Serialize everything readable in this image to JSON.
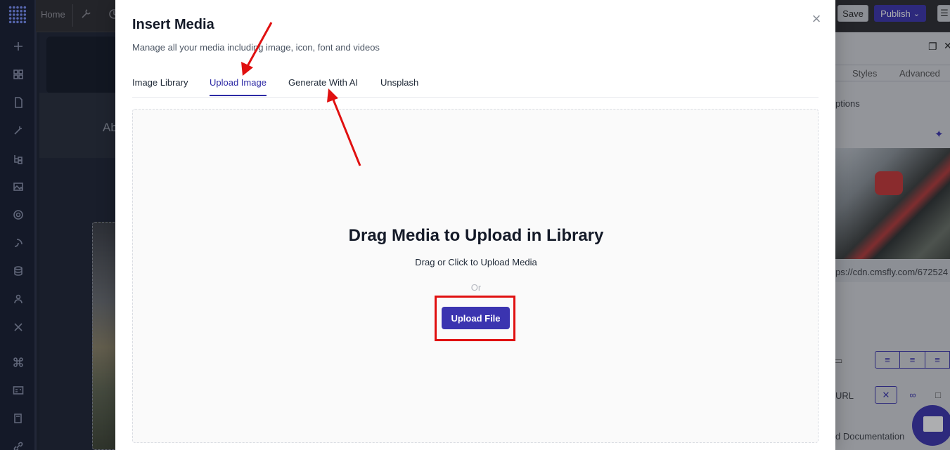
{
  "editor": {
    "home_label": "Home",
    "canvas_text": "Ab",
    "save_label": "Save",
    "publish_label": "Publish",
    "panel_tabs": [
      "Styles",
      "Advanced"
    ],
    "panel_options_text": "ptions",
    "image_url_text": "ps://cdn.cmsfly.com/672524",
    "link_label": "URL",
    "docs_text": "d Documentation"
  },
  "modal": {
    "title": "Insert Media",
    "subtitle": "Manage all your media including image, icon, font and videos",
    "close_glyph": "×",
    "tabs": [
      {
        "label": "Image Library",
        "active": false
      },
      {
        "label": "Upload Image",
        "active": true
      },
      {
        "label": "Generate With AI",
        "active": false
      },
      {
        "label": "Unsplash",
        "active": false
      }
    ],
    "dropzone": {
      "heading": "Drag Media to Upload in Library",
      "hint": "Drag or Click to Upload Media",
      "or_text": "Or",
      "button_label": "Upload File"
    }
  },
  "colors": {
    "accent": "#3b34b0",
    "annotation": "#e01010",
    "rail": "#141b2f"
  },
  "icons": [
    "grid-logo-icon",
    "plus-icon",
    "layout-icon",
    "page-icon",
    "magic-icon",
    "tree-icon",
    "image-icon",
    "gear-icon",
    "plug-icon",
    "database-icon",
    "users-icon",
    "tools-icon",
    "command-icon",
    "id-card-icon",
    "book-icon",
    "link-icon",
    "wrench-icon",
    "close-icon",
    "chevron-down-icon",
    "sparkle-icon",
    "chat-icon"
  ]
}
